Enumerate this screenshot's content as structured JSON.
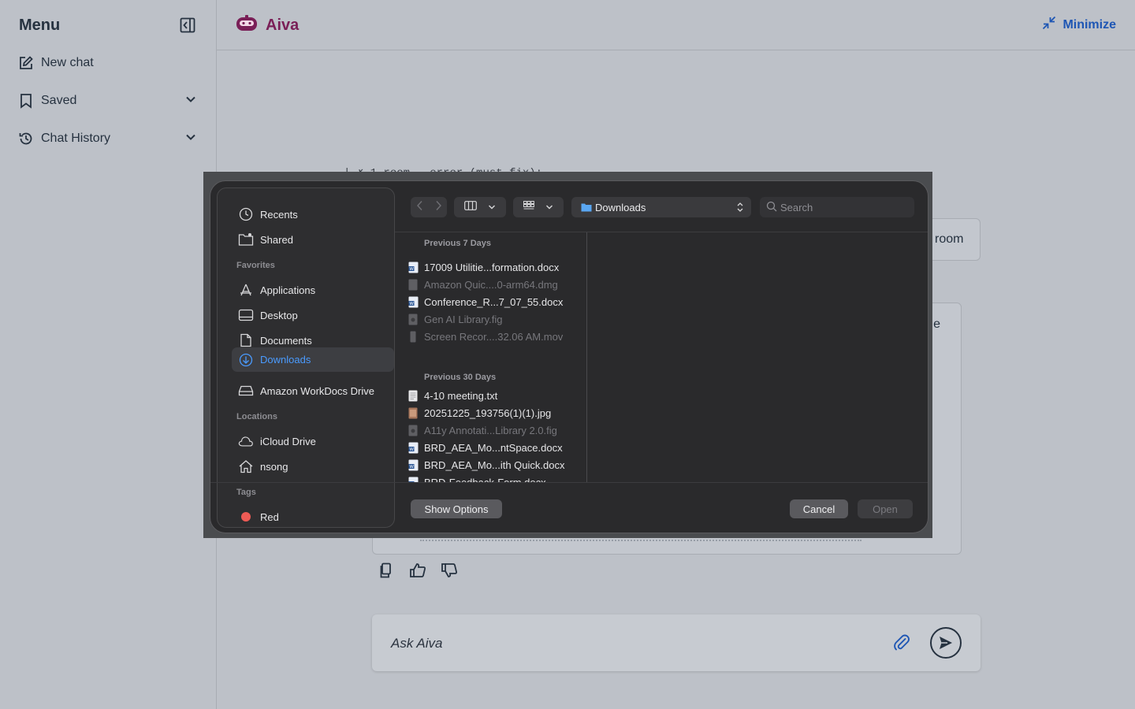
{
  "sidebar": {
    "title": "Menu",
    "items": [
      {
        "label": "New chat",
        "icon": "edit-icon"
      },
      {
        "label": "Saved",
        "icon": "bookmark-icon"
      },
      {
        "label": "Chat History",
        "icon": "history-icon"
      }
    ]
  },
  "header": {
    "brand": "Aiva",
    "minimize_label": "Minimize"
  },
  "chat": {
    "code_snippet": "| ✗  1 room — error (must fix):",
    "user_fragment": "room",
    "ai_fragment": "e"
  },
  "composer": {
    "placeholder": "Ask Aiva"
  },
  "dialog": {
    "sidebar": {
      "top": [
        {
          "label": "Recents",
          "icon": "clock-icon"
        },
        {
          "label": "Shared",
          "icon": "shared-folder-icon"
        }
      ],
      "favorites_label": "Favorites",
      "favorites": [
        {
          "label": "Applications",
          "icon": "applications-icon"
        },
        {
          "label": "Desktop",
          "icon": "desktop-icon"
        },
        {
          "label": "Documents",
          "icon": "document-icon"
        },
        {
          "label": "Downloads",
          "icon": "downloads-icon",
          "active": true
        },
        {
          "label": "Amazon WorkDocs Drive",
          "icon": "drive-icon"
        }
      ],
      "locations_label": "Locations",
      "locations": [
        {
          "label": "iCloud Drive",
          "icon": "cloud-icon"
        },
        {
          "label": "nsong",
          "icon": "home-icon"
        }
      ],
      "tags_label": "Tags",
      "tags": [
        {
          "label": "Red",
          "color": "#ee5b55"
        }
      ]
    },
    "location": "Downloads",
    "search_placeholder": "Search",
    "sections": [
      {
        "label": "Previous 7 Days",
        "files": [
          {
            "name": "17009 Utilitie...formation.docx",
            "type": "docx",
            "dim": false
          },
          {
            "name": "Amazon Quic....0-arm64.dmg",
            "type": "generic",
            "dim": true
          },
          {
            "name": "Conference_R...7_07_55.docx",
            "type": "docx",
            "dim": false
          },
          {
            "name": "Gen AI Library.fig",
            "type": "generic",
            "dim": true
          },
          {
            "name": "Screen Recor....32.06 AM.mov",
            "type": "video",
            "dim": true
          }
        ]
      },
      {
        "label": "Previous 30 Days",
        "files": [
          {
            "name": "4-10 meeting.txt",
            "type": "txt",
            "dim": false
          },
          {
            "name": "20251225_193756(1)(1).jpg",
            "type": "image",
            "dim": false
          },
          {
            "name": "A11y Annotati...Library 2.0.fig",
            "type": "generic",
            "dim": true
          },
          {
            "name": "BRD_AEA_Mo...ntSpace.docx",
            "type": "docx",
            "dim": false
          },
          {
            "name": "BRD_AEA_Mo...ith Quick.docx",
            "type": "docx",
            "dim": false
          },
          {
            "name": "BRD-Feedback-Form.docx",
            "type": "docx",
            "dim": false
          }
        ]
      }
    ],
    "buttons": {
      "show_options": "Show Options",
      "cancel": "Cancel",
      "open": "Open"
    }
  }
}
